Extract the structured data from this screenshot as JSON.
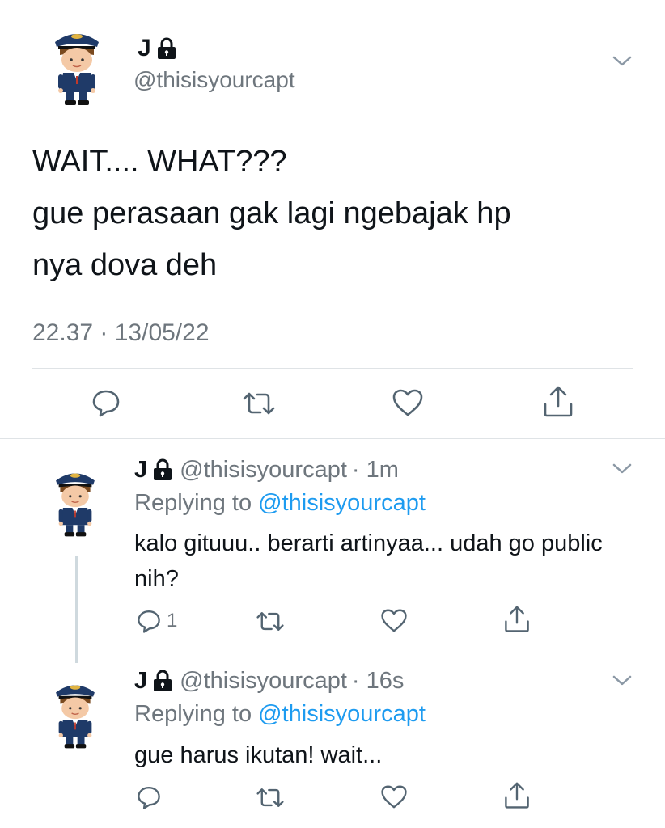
{
  "main_tweet": {
    "name": "J",
    "handle": "@thisisyourcapt",
    "text_lines": [
      "WAIT.... WHAT???",
      "gue perasaan gak lagi ngebajak hp",
      "nya dova deh"
    ],
    "timestamp": "22.37 · 13/05/22"
  },
  "replies": [
    {
      "name": "J",
      "handle": "@thisisyourcapt",
      "time": "· 1m",
      "replying_prefix": "Replying to",
      "replying_to": "@thisisyourcapt",
      "text": "kalo gituuu.. berarti artinyaa... udah go public nih?",
      "reply_count": "1"
    },
    {
      "name": "J",
      "handle": "@thisisyourcapt",
      "time": "· 16s",
      "replying_prefix": "Replying to",
      "replying_to": "@thisisyourcapt",
      "text": "gue harus ikutan! wait...",
      "reply_count": ""
    }
  ],
  "colors": {
    "text": "#0f1419",
    "secondary": "#6e767d",
    "accent": "#1d9bf0",
    "icon": "#536471"
  },
  "icons": [
    "pilot-avatar",
    "lock-icon",
    "chevron-down-icon",
    "reply-icon",
    "retweet-icon",
    "like-icon",
    "share-icon"
  ]
}
